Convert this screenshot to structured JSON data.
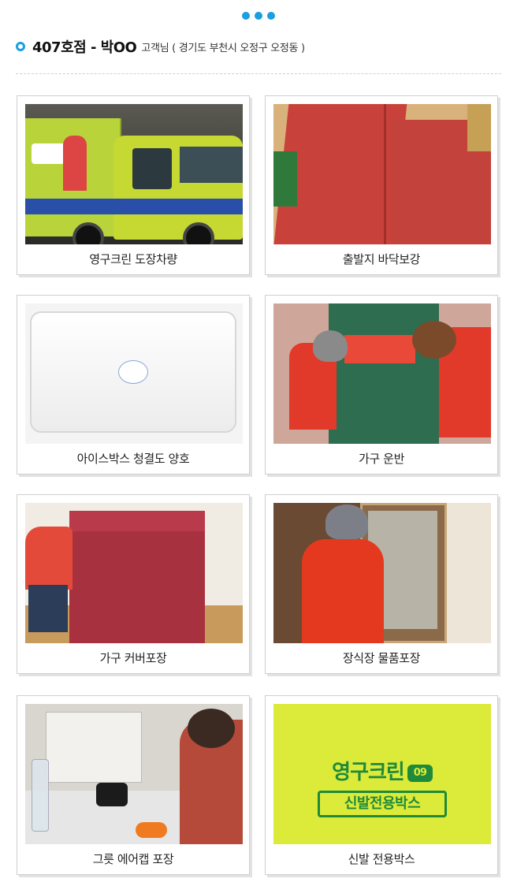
{
  "header": {
    "title": "407호점 - 박OO",
    "subtitle": "고객님 ( 경기도 부천시 오정구 오정동 )"
  },
  "photos": [
    {
      "caption": "영구크린 도장차량"
    },
    {
      "caption": "출발지 바닥보강"
    },
    {
      "caption": "아이스박스 청결도 양호"
    },
    {
      "caption": "가구 운반"
    },
    {
      "caption": "가구 커버포장"
    },
    {
      "caption": "장식장 물품포장"
    },
    {
      "caption": "그릇 에어캡 포장"
    },
    {
      "caption": "신발 전용박스"
    }
  ],
  "shoebox": {
    "brand": "영구크린",
    "badge": "09",
    "label": "신발전용박스"
  },
  "colors": {
    "accent": "#1a9fe0",
    "border": "#cfcfcf",
    "shoebox_green": "#1f8a3a",
    "shoebox_yellow": "#dcea3a"
  }
}
